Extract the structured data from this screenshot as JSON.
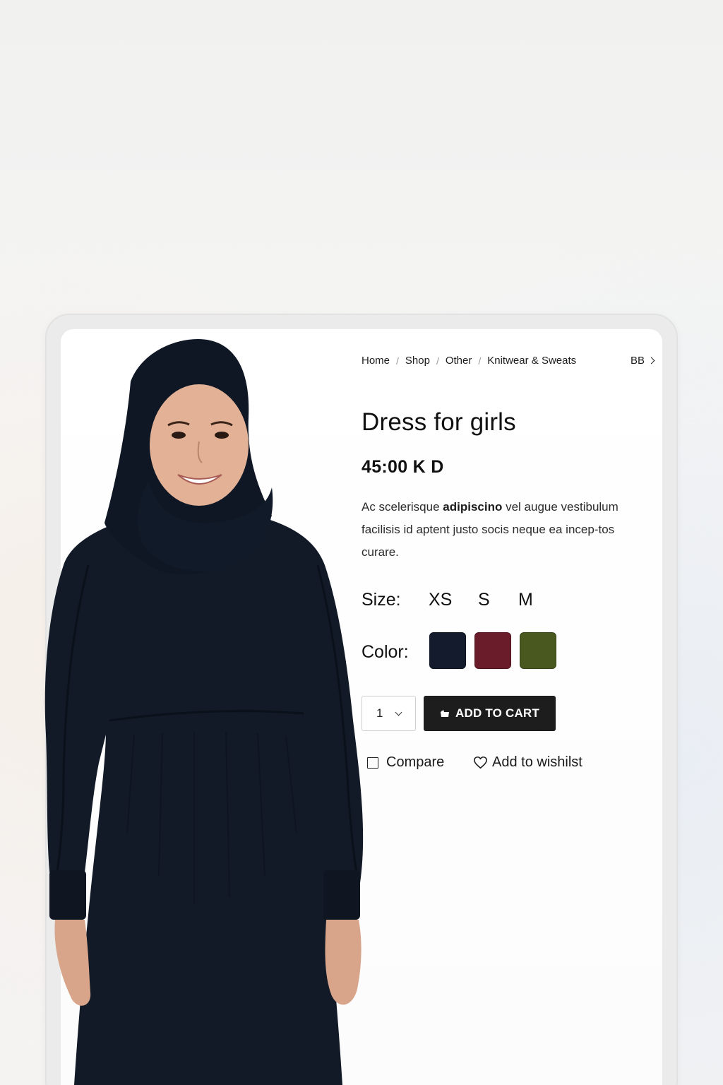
{
  "breadcrumb": {
    "items": [
      "Home",
      "Shop",
      "Other",
      "Knitwear & Sweats"
    ],
    "separator": "/",
    "more_label": "BB"
  },
  "product": {
    "title": "Dress for girls",
    "price": "45:00 K D",
    "description_parts": [
      "Ac scelerisque ",
      "adipiscino",
      " vel augue vestibulum facilisis id aptent justo socis neque ea incep-tos curare."
    ],
    "size_label": "Size:",
    "sizes": [
      "XS",
      "S",
      "M"
    ],
    "color_label": "Color:",
    "colors": [
      "#141b2c",
      "#6b1c2a",
      "#49581f"
    ],
    "quantity": "1",
    "add_to_cart_label": "ADD TO CART",
    "compare_label": "Compare",
    "wishlist_label": "Add to wishilst"
  },
  "icons": {
    "breadcrumb_more": "chevron-right-icon",
    "quantity": "chevron-down-icon",
    "cart": "cart-icon",
    "compare": "checkbox-icon",
    "wishlist": "heart-icon"
  }
}
